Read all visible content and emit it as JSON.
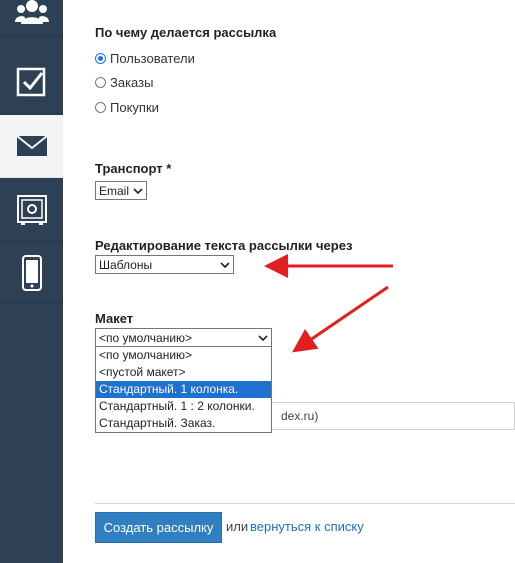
{
  "sidebar": {
    "items": [
      {
        "icon": "users-icon"
      },
      {
        "icon": "checkbox-icon"
      },
      {
        "icon": "mail-icon",
        "active": true
      },
      {
        "icon": "safe-icon"
      },
      {
        "icon": "mobile-icon"
      }
    ]
  },
  "form": {
    "trigger": {
      "label": "По чему делается рассылка",
      "options": [
        "Пользователи",
        "Заказы",
        "Покупки"
      ],
      "selected": "Пользователи"
    },
    "transport": {
      "label": "Транспорт *",
      "value": "Email"
    },
    "editing": {
      "label": "Редактирование текста рассылки через",
      "value": "Шаблоны"
    },
    "layout": {
      "label": "Макет",
      "value": "<по умолчанию>",
      "options": [
        "<по умолчанию>",
        "<пустой макет>",
        "Стандартный. 1 колонка.",
        "Стандартный. 1 : 2 колонки.",
        "Стандартный. Заказ."
      ],
      "highlighted": "Стандартный. 1 колонка."
    },
    "partial_field_text": "dex.ru)"
  },
  "actions": {
    "submit_label": "Создать рассылку",
    "or_text": "или",
    "back_link": "вернуться к списку"
  },
  "colors": {
    "sidebar_bg": "#2e4053",
    "button_bg": "#2f7fc1",
    "link": "#1f6fbf",
    "arrow": "#e02020",
    "highlight": "#1e70d1"
  }
}
